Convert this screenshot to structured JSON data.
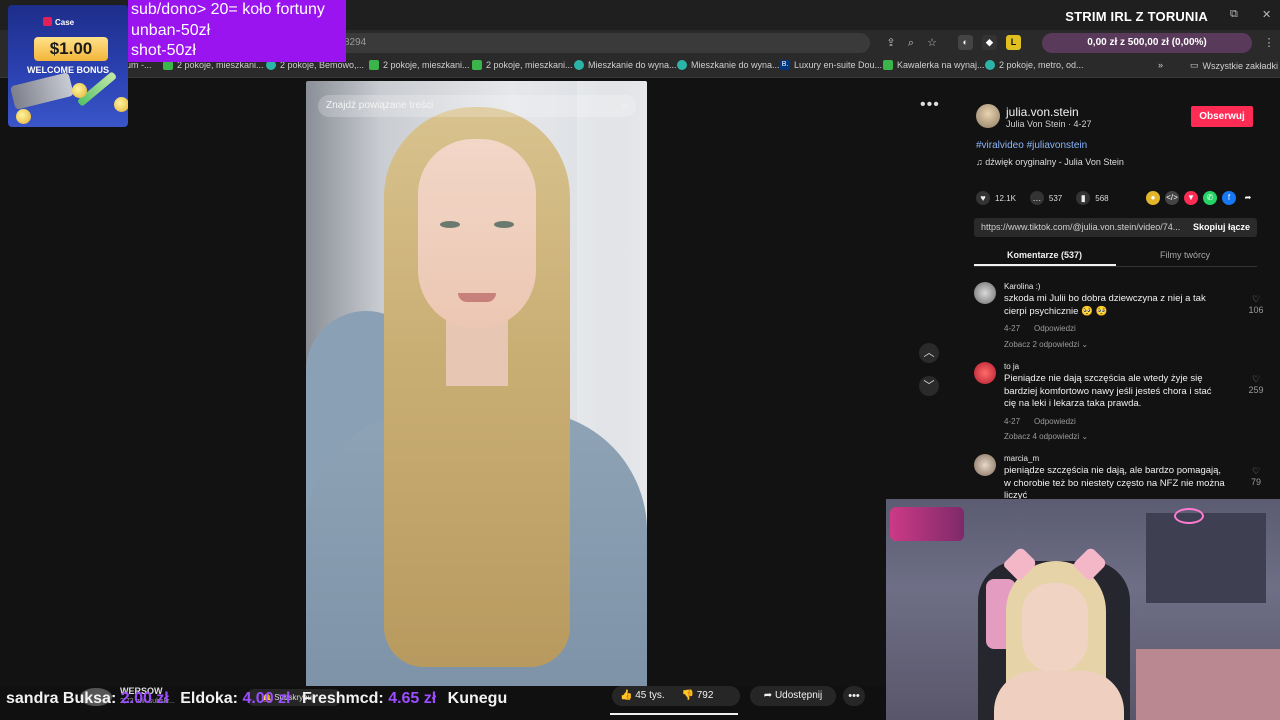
{
  "stream": {
    "title": "STRIM IRL Z TORUNIA"
  },
  "browser": {
    "url_fragment": "8294",
    "wallet": "0,00 zł z 500,00 zł (0,00%)",
    "all_bookmarks": "Wszystkie zakładki",
    "bookmarks": [
      "um -...",
      "2 pokoje, mieszkani...",
      "2 pokoje, Bemowo,...",
      "2 pokoje, mieszkani...",
      "2 pokoje, mieszkani...",
      "Mieszkanie do wyna...",
      "Mieszkanie do wyna...",
      "Luxury en-suite Dou...",
      "Kawalerka na wynaj...",
      "2 pokoje, metro, od..."
    ]
  },
  "video": {
    "search_placeholder": "Znajdź powiązane treści"
  },
  "post": {
    "username": "julia.von.stein",
    "display_line": "Julia Von Stein · 4-27",
    "follow_label": "Obserwuj",
    "hashtags": "#viralvideo #juliavonstein",
    "sound": "dźwięk oryginalny - Julia Von Stein",
    "likes": "12.1K",
    "comments": "537",
    "saves": "568",
    "link_url": "https://www.tiktok.com/@julia.von.stein/video/74...",
    "copy_label": "Skopiuj łącze",
    "tab_comments": "Komentarze (537)",
    "tab_creator": "Filmy twórcy"
  },
  "comments": [
    {
      "user": "Karolina :)",
      "text": "szkoda mi Julii bo dobra dziewczyna z niej a tak cierpi psychicznie 🥺 🥺",
      "date": "4-27",
      "reply": "Odpowiedzi",
      "more": "Zobacz 2 odpowiedzi ⌄",
      "likes": "106"
    },
    {
      "user": "to ja",
      "text": "Pieniądze nie dają szczęścia ale wtedy żyje się bardziej komfortowo nawy jeśli jesteś chora i stać cię na leki i lekarza taka prawda.",
      "date": "4-27",
      "reply": "Odpowiedzi",
      "more": "Zobacz 4 odpowiedzi ⌄",
      "likes": "259"
    },
    {
      "user": "marcia_m",
      "text": "pieniądze szczęścia nie dają, ale bardzo pomagają, w chorobie też bo niestety często na NFZ nie można liczyć",
      "likes": "79"
    }
  ],
  "promo": {
    "brand": "Case",
    "amount": "$1.00",
    "bonus": "WELCOME BONUS"
  },
  "overlay": {
    "lines": [
      "sub/dono> 20= koło fortuny",
      "unban-50zł",
      "shot-50zł"
    ]
  },
  "youtube": {
    "channel": "WERSOW",
    "subs": "2,72 mln subskr...",
    "subscribe": "Subskrybuj",
    "likes": "45 tys.",
    "dislikes": "792",
    "share": "Udostępnij"
  },
  "ticker": [
    {
      "name": "sandra Buksa:",
      "amount": "2.00 zł"
    },
    {
      "name": "Eldoka:",
      "amount": "4.00 zł"
    },
    {
      "name": "Freshmcd:",
      "amount": "4.65 zł"
    },
    {
      "name": "Kunegu",
      "amount": ""
    }
  ]
}
